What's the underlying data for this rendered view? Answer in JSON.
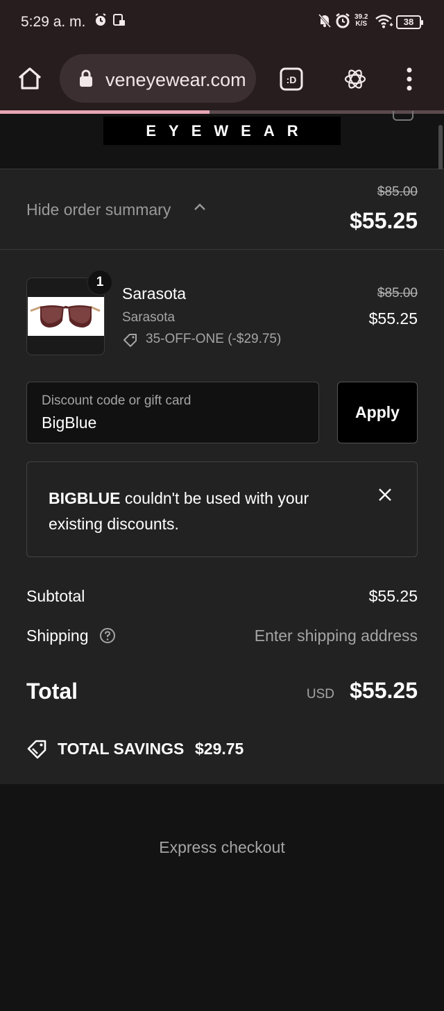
{
  "status_bar": {
    "time": "5:29 a. m.",
    "net_speed_value": "39.2",
    "net_speed_unit": "K/S",
    "battery": "38",
    "icons": [
      "alarm-icon",
      "sim-icon",
      "mute-icon",
      "alarm-icon",
      "wifi-icon",
      "battery-icon"
    ]
  },
  "browser": {
    "url": "veneyewear.com",
    "icons": [
      "home-icon",
      "lock-icon",
      "tab-switcher-icon",
      "openai-icon",
      "more-vertical-icon"
    ],
    "tab_button_label": ":D",
    "accent": "#e8a5b4"
  },
  "header": {
    "logo_text": "EYEWEAR"
  },
  "order_summary": {
    "toggle_label": "Hide order summary",
    "original_total": "$85.00",
    "total": "$55.25"
  },
  "line_item": {
    "quantity": "1",
    "name": "Sarasota",
    "variant": "Sarasota",
    "discount": "35-OFF-ONE (-$29.75)",
    "original_price": "$85.00",
    "price": "$55.25"
  },
  "discount_form": {
    "placeholder": "Discount code or gift card",
    "value": "BigBlue",
    "apply_label": "Apply"
  },
  "error": {
    "code": "BIGBLUE",
    "message": " couldn't be used with your existing discounts."
  },
  "totals": {
    "subtotal_label": "Subtotal",
    "subtotal_value": "$55.25",
    "shipping_label": "Shipping",
    "shipping_value": "Enter shipping address",
    "total_label": "Total",
    "currency": "USD",
    "total_value": "$55.25",
    "savings_label": "TOTAL SAVINGS",
    "savings_value": "$29.75"
  },
  "express_checkout": {
    "label": "Express checkout"
  }
}
